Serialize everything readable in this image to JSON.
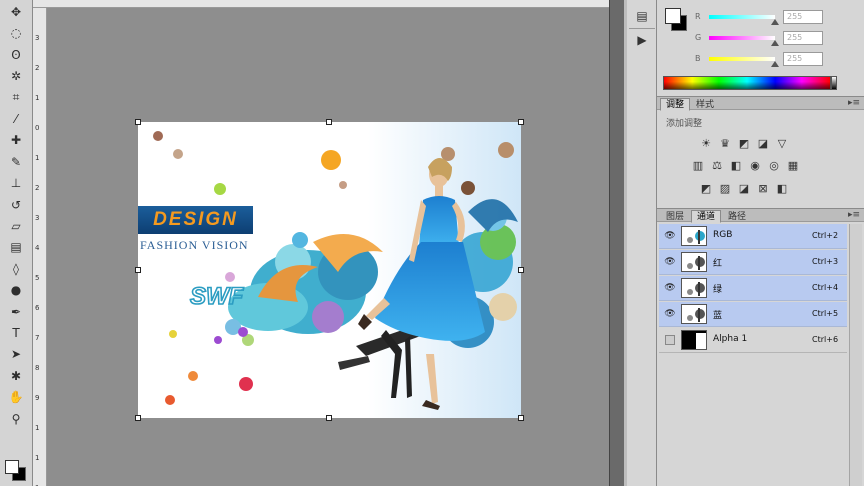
{
  "toolbar": {
    "tools": [
      {
        "name": "move-tool-icon",
        "glyph": "✥"
      },
      {
        "name": "marquee-tool-icon",
        "glyph": "◌"
      },
      {
        "name": "lasso-tool-icon",
        "glyph": "ʘ"
      },
      {
        "name": "quick-select-tool-icon",
        "glyph": "✲"
      },
      {
        "name": "crop-tool-icon",
        "glyph": "⌗"
      },
      {
        "name": "eyedropper-tool-icon",
        "glyph": "⁄"
      },
      {
        "name": "healing-brush-tool-icon",
        "glyph": "✚"
      },
      {
        "name": "brush-tool-icon",
        "glyph": "✎"
      },
      {
        "name": "clone-stamp-tool-icon",
        "glyph": "⊥"
      },
      {
        "name": "history-brush-tool-icon",
        "glyph": "↺"
      },
      {
        "name": "eraser-tool-icon",
        "glyph": "▱"
      },
      {
        "name": "gradient-tool-icon",
        "glyph": "▤"
      },
      {
        "name": "blur-tool-icon",
        "glyph": "◊"
      },
      {
        "name": "dodge-tool-icon",
        "glyph": "●"
      },
      {
        "name": "pen-tool-icon",
        "glyph": "✒"
      },
      {
        "name": "type-tool-icon",
        "glyph": "T"
      },
      {
        "name": "path-select-tool-icon",
        "glyph": "➤"
      },
      {
        "name": "shape-tool-icon",
        "glyph": "✱"
      },
      {
        "name": "hand-tool-icon",
        "glyph": "✋"
      },
      {
        "name": "zoom-tool-icon",
        "glyph": "⚲"
      }
    ]
  },
  "rulers": {
    "left": [
      "3",
      "2",
      "1",
      "0",
      "1",
      "2",
      "3",
      "4",
      "5",
      "6",
      "7",
      "8",
      "9",
      "1",
      "1",
      "1"
    ]
  },
  "document": {
    "design_text": "DESIGN",
    "fashion_text": "FASHION VISION",
    "swf_text": "SWF"
  },
  "dock": {
    "buttons": [
      {
        "name": "history-panel-icon",
        "glyph": "▤"
      },
      {
        "name": "actions-panel-icon",
        "glyph": "▶"
      }
    ]
  },
  "color_panel": {
    "rows": [
      {
        "label": "R",
        "value": "255",
        "gradient": "linear-gradient(90deg,#00ffff,#ffffff)"
      },
      {
        "label": "G",
        "value": "255",
        "gradient": "linear-gradient(90deg,#ff00ff,#ffffff)"
      },
      {
        "label": "B",
        "value": "255",
        "gradient": "linear-gradient(90deg,#ffff00,#ffffff)"
      }
    ]
  },
  "adjustments_panel": {
    "tabs": [
      "调整",
      "样式"
    ],
    "title": "添加调整",
    "icons_row1": [
      {
        "name": "brightness-icon",
        "glyph": "☀"
      },
      {
        "name": "levels-icon",
        "glyph": "♛"
      },
      {
        "name": "curves-icon",
        "glyph": "◩"
      },
      {
        "name": "exposure-icon",
        "glyph": "◪"
      },
      {
        "name": "vibrance-icon",
        "glyph": "▽"
      }
    ],
    "icons_row2": [
      {
        "name": "hue-saturation-icon",
        "glyph": "▥"
      },
      {
        "name": "color-balance-icon",
        "glyph": "⚖"
      },
      {
        "name": "black-white-icon",
        "glyph": "◧"
      },
      {
        "name": "photo-filter-icon",
        "glyph": "◉"
      },
      {
        "name": "channel-mixer-icon",
        "glyph": "◎"
      },
      {
        "name": "color-lookup-icon",
        "glyph": "▦"
      }
    ],
    "icons_row3": [
      {
        "name": "invert-icon",
        "glyph": "◩"
      },
      {
        "name": "posterize-icon",
        "glyph": "▨"
      },
      {
        "name": "threshold-icon",
        "glyph": "◪"
      },
      {
        "name": "selective-color-icon",
        "glyph": "⊠"
      },
      {
        "name": "gradient-map-icon",
        "glyph": "◧"
      }
    ]
  },
  "channels_panel": {
    "tabs": [
      "图层",
      "通道",
      "路径"
    ],
    "active_tab": "通道",
    "rows": [
      {
        "name": "RGB",
        "key": "Ctrl+2",
        "visible": true,
        "selected": true
      },
      {
        "name": "红",
        "key": "Ctrl+3",
        "visible": true,
        "selected": true
      },
      {
        "name": "绿",
        "key": "Ctrl+4",
        "visible": true,
        "selected": true
      },
      {
        "name": "蓝",
        "key": "Ctrl+5",
        "visible": true,
        "selected": true
      },
      {
        "name": "Alpha 1",
        "key": "Ctrl+6",
        "visible": false,
        "selected": false
      }
    ]
  },
  "colors": {
    "selection": "#b8caf0",
    "workspace": "#8e8e8e",
    "panel": "#d6d6d6"
  }
}
